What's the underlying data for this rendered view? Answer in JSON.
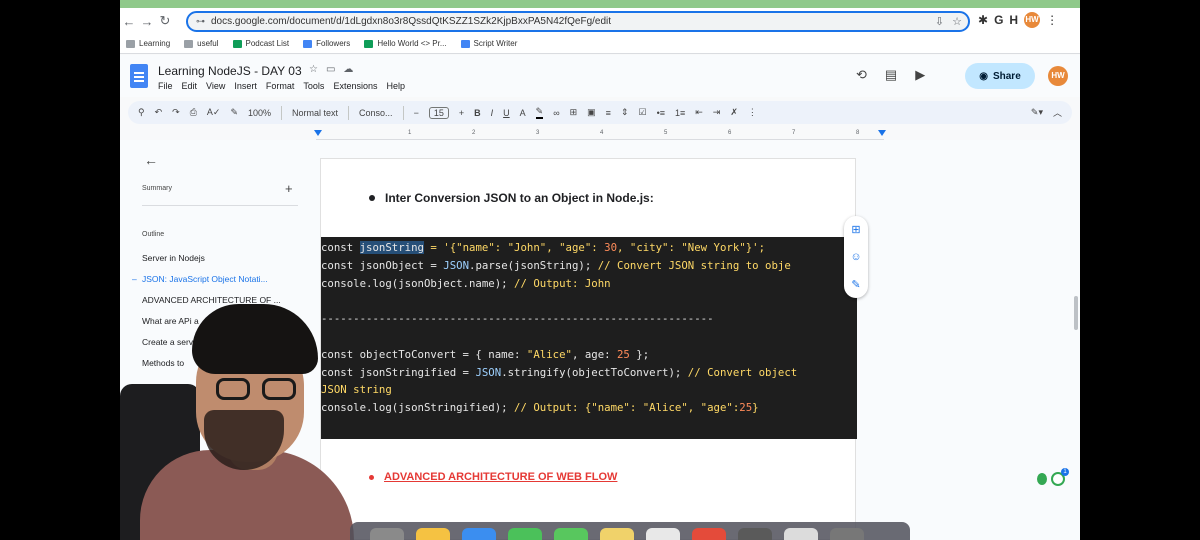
{
  "browser": {
    "url": "docs.google.com/document/d/1dLgdxn8o3r8QssdQtKSZZ1SZk2KjpBxxPA5N42fQeFg/edit",
    "bookmarks": [
      "Learning",
      "useful",
      "Podcast List",
      "Followers",
      "Hello World <> Pr...",
      "Script Writer"
    ],
    "profile_initials": "HW"
  },
  "doc": {
    "title": "Learning NodeJS - DAY 03",
    "menu": [
      "File",
      "Edit",
      "View",
      "Insert",
      "Format",
      "Tools",
      "Extensions",
      "Help"
    ],
    "share_label": "Share",
    "user_initials": "HW"
  },
  "toolbar": {
    "zoom": "100%",
    "style": "Normal text",
    "font": "Conso...",
    "font_size": "15"
  },
  "ruler": [
    "1",
    "2",
    "3",
    "4",
    "5",
    "6",
    "7",
    "8"
  ],
  "sidebar": {
    "summary_label": "Summary",
    "outline_label": "Outline",
    "items": [
      {
        "label": "Server in Nodejs"
      },
      {
        "label": "JSON: JavaScript Object Notati..."
      },
      {
        "label": "ADVANCED ARCHITECTURE OF ..."
      },
      {
        "label": "What are APi a"
      },
      {
        "label": "Create a serv"
      },
      {
        "label": "Methods to"
      }
    ]
  },
  "page": {
    "heading": "Inter Conversion JSON to an Object in Node.js:",
    "code": [
      {
        "parts": [
          {
            "t": "const ",
            "c": ""
          },
          {
            "t": "jsonString",
            "c": "sel"
          },
          {
            "t": " = '{\"name\": \"John\", \"age\": ",
            "c": "k-str"
          },
          {
            "t": "30",
            "c": "k-num"
          },
          {
            "t": ", \"city\": \"New York\"}';",
            "c": "k-str"
          }
        ]
      },
      {
        "parts": [
          {
            "t": "const jsonObject = ",
            "c": ""
          },
          {
            "t": "JSON",
            "c": "k-obj"
          },
          {
            "t": ".parse(jsonString); ",
            "c": ""
          },
          {
            "t": "// Convert JSON string to obje",
            "c": "k-str"
          }
        ]
      },
      {
        "parts": [
          {
            "t": "console.log(jsonObject.name); ",
            "c": ""
          },
          {
            "t": "// Output: John",
            "c": "k-str"
          }
        ]
      },
      {
        "parts": [
          {
            "t": "",
            "c": ""
          }
        ]
      },
      {
        "parts": [
          {
            "t": "-------------------------------------------------------------",
            "c": ""
          }
        ]
      },
      {
        "parts": [
          {
            "t": "",
            "c": ""
          }
        ]
      },
      {
        "parts": [
          {
            "t": "const objectToConvert = { name: ",
            "c": ""
          },
          {
            "t": "\"Alice\"",
            "c": "k-str"
          },
          {
            "t": ", age: ",
            "c": ""
          },
          {
            "t": "25",
            "c": "k-num"
          },
          {
            "t": " };",
            "c": ""
          }
        ]
      },
      {
        "parts": [
          {
            "t": "const jsonStringified = ",
            "c": ""
          },
          {
            "t": "JSON",
            "c": "k-obj"
          },
          {
            "t": ".stringify(objectToConvert); ",
            "c": ""
          },
          {
            "t": "// Convert object",
            "c": "k-str"
          }
        ]
      },
      {
        "parts": [
          {
            "t": "JSON string",
            "c": "k-str"
          }
        ]
      },
      {
        "parts": [
          {
            "t": "console.log(jsonStringified); ",
            "c": ""
          },
          {
            "t": "// Output: {\"name\": \"Alice\", \"age\":",
            "c": "k-str"
          },
          {
            "t": "25",
            "c": "k-num"
          },
          {
            "t": "}",
            "c": "k-str"
          }
        ]
      }
    ],
    "next_heading": "ADVANCED ARCHITECTURE OF WEB FLOW"
  }
}
